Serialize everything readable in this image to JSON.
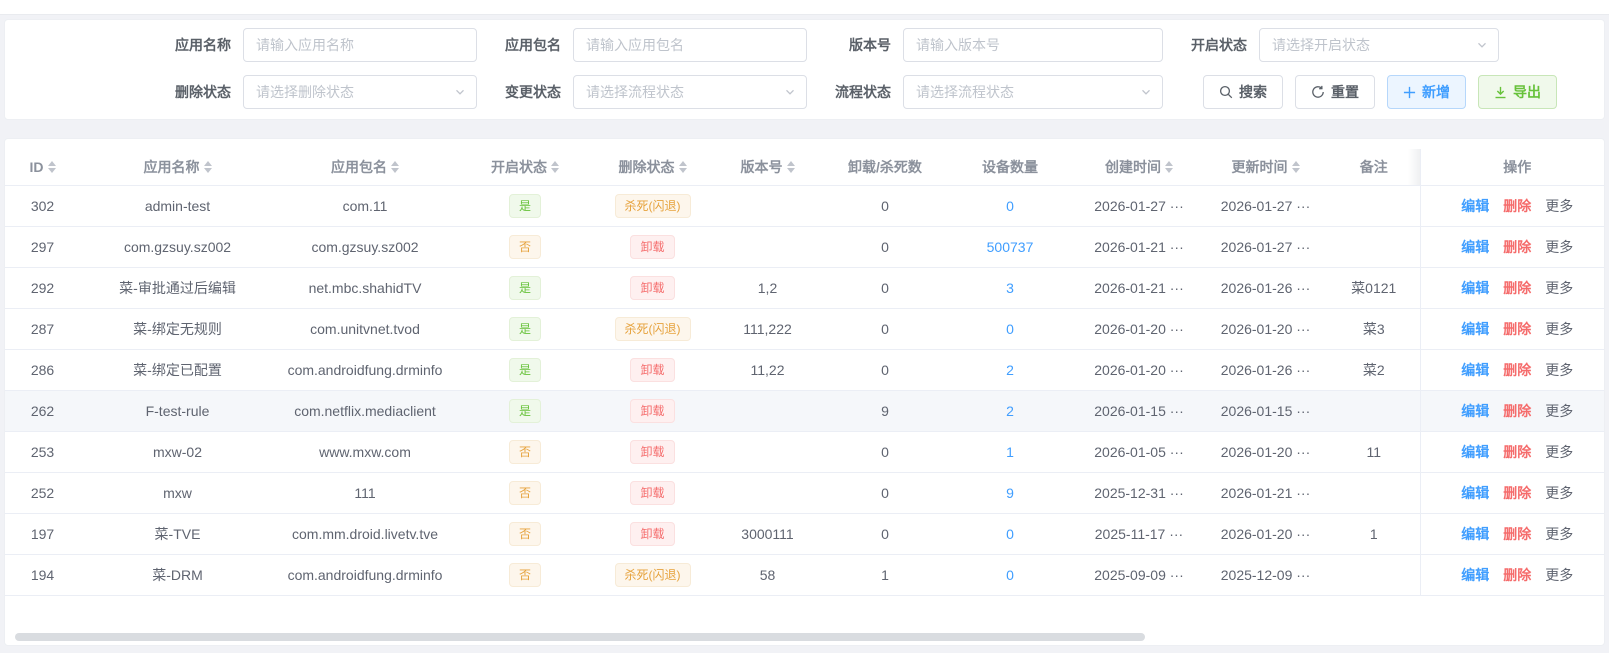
{
  "colors": {
    "primary": "#409eff",
    "success": "#67c23a",
    "warning": "#e6a23c",
    "danger": "#f56c6c",
    "page_background": "#f1f2f6"
  },
  "filter": {
    "fields": [
      {
        "row": 1,
        "key": "app-name",
        "label": "应用名称",
        "type": "input",
        "placeholder": "请输入应用名称"
      },
      {
        "row": 1,
        "key": "app-package",
        "label": "应用包名",
        "type": "input",
        "placeholder": "请输入应用包名"
      },
      {
        "row": 1,
        "key": "version",
        "label": "版本号",
        "type": "input",
        "placeholder": "请输入版本号"
      },
      {
        "row": 1,
        "key": "enable-status",
        "label": "开启状态",
        "type": "select",
        "placeholder": "请选择开启状态"
      },
      {
        "row": 2,
        "key": "delete-status",
        "label": "删除状态",
        "type": "select",
        "placeholder": "请选择删除状态"
      },
      {
        "row": 2,
        "key": "change-status",
        "label": "变更状态",
        "type": "select",
        "placeholder": "请选择流程状态"
      },
      {
        "row": 2,
        "key": "process-status",
        "label": "流程状态",
        "type": "select",
        "placeholder": "请选择流程状态"
      }
    ],
    "buttons": [
      {
        "key": "search",
        "label": "搜索",
        "icon": "search-icon",
        "variant": "default"
      },
      {
        "key": "reset",
        "label": "重置",
        "icon": "refresh-icon",
        "variant": "default"
      },
      {
        "key": "add",
        "label": "新增",
        "icon": "plus-icon",
        "variant": "primary"
      },
      {
        "key": "export",
        "label": "导出",
        "icon": "download-icon",
        "variant": "success"
      }
    ]
  },
  "table": {
    "columns": [
      {
        "key": "id",
        "label": "ID",
        "sortable": true
      },
      {
        "key": "name",
        "label": "应用名称",
        "sortable": true
      },
      {
        "key": "package",
        "label": "应用包名",
        "sortable": true
      },
      {
        "key": "enabled",
        "label": "开启状态",
        "sortable": true
      },
      {
        "key": "delstate",
        "label": "删除状态",
        "sortable": true
      },
      {
        "key": "version",
        "label": "版本号",
        "sortable": true
      },
      {
        "key": "killcount",
        "label": "卸载/杀死数",
        "sortable": false
      },
      {
        "key": "devices",
        "label": "设备数量",
        "sortable": false
      },
      {
        "key": "created",
        "label": "创建时间",
        "sortable": true
      },
      {
        "key": "updated",
        "label": "更新时间",
        "sortable": true
      },
      {
        "key": "remark",
        "label": "备注",
        "sortable": false
      },
      {
        "key": "actions",
        "label": "操作",
        "sortable": false
      }
    ],
    "action_labels": {
      "edit": "编辑",
      "delete": "删除",
      "more": "更多"
    },
    "rows": [
      {
        "id": "302",
        "name": "admin-test",
        "package": "com.11",
        "enabled": {
          "text": "是",
          "type": "success"
        },
        "delete_state": {
          "text": "杀死(闪退)",
          "type": "warning"
        },
        "version": "",
        "uninstall_kill_count": "0",
        "device_count": "0",
        "created": "2026-01-27 ···",
        "updated": "2026-01-27 ···",
        "remark": "",
        "highlighted": false
      },
      {
        "id": "297",
        "name": "com.gzsuy.sz002",
        "package": "com.gzsuy.sz002",
        "enabled": {
          "text": "否",
          "type": "warning"
        },
        "delete_state": {
          "text": "卸载",
          "type": "danger"
        },
        "version": "",
        "uninstall_kill_count": "0",
        "device_count": "500737",
        "created": "2026-01-21 ···",
        "updated": "2026-01-27 ···",
        "remark": "",
        "highlighted": false
      },
      {
        "id": "292",
        "name": "菜-审批通过后编辑",
        "package": "net.mbc.shahidTV",
        "enabled": {
          "text": "是",
          "type": "success"
        },
        "delete_state": {
          "text": "卸载",
          "type": "danger"
        },
        "version": "1,2",
        "uninstall_kill_count": "0",
        "device_count": "3",
        "created": "2026-01-21 ···",
        "updated": "2026-01-26 ···",
        "remark": "菜0121",
        "highlighted": false
      },
      {
        "id": "287",
        "name": "菜-绑定无规则",
        "package": "com.unitvnet.tvod",
        "enabled": {
          "text": "是",
          "type": "success"
        },
        "delete_state": {
          "text": "杀死(闪退)",
          "type": "warning"
        },
        "version": "111,222",
        "uninstall_kill_count": "0",
        "device_count": "0",
        "created": "2026-01-20 ···",
        "updated": "2026-01-20 ···",
        "remark": "菜3",
        "highlighted": false
      },
      {
        "id": "286",
        "name": "菜-绑定已配置",
        "package": "com.androidfung.drminfo",
        "enabled": {
          "text": "是",
          "type": "success"
        },
        "delete_state": {
          "text": "卸载",
          "type": "danger"
        },
        "version": "11,22",
        "uninstall_kill_count": "0",
        "device_count": "2",
        "created": "2026-01-20 ···",
        "updated": "2026-01-26 ···",
        "remark": "菜2",
        "highlighted": false
      },
      {
        "id": "262",
        "name": "F-test-rule",
        "package": "com.netflix.mediaclient",
        "enabled": {
          "text": "是",
          "type": "success"
        },
        "delete_state": {
          "text": "卸载",
          "type": "danger"
        },
        "version": "",
        "uninstall_kill_count": "9",
        "device_count": "2",
        "created": "2026-01-15 ···",
        "updated": "2026-01-15 ···",
        "remark": "",
        "highlighted": true
      },
      {
        "id": "253",
        "name": "mxw-02",
        "package": "www.mxw.com",
        "enabled": {
          "text": "否",
          "type": "warning"
        },
        "delete_state": {
          "text": "卸载",
          "type": "danger"
        },
        "version": "",
        "uninstall_kill_count": "0",
        "device_count": "1",
        "created": "2026-01-05 ···",
        "updated": "2026-01-20 ···",
        "remark": "11",
        "highlighted": false
      },
      {
        "id": "252",
        "name": "mxw",
        "package": "111",
        "enabled": {
          "text": "否",
          "type": "warning"
        },
        "delete_state": {
          "text": "卸载",
          "type": "danger"
        },
        "version": "",
        "uninstall_kill_count": "0",
        "device_count": "9",
        "created": "2025-12-31 ···",
        "updated": "2026-01-21 ···",
        "remark": "",
        "highlighted": false
      },
      {
        "id": "197",
        "name": "菜-TVE",
        "package": "com.mm.droid.livetv.tve",
        "enabled": {
          "text": "否",
          "type": "warning"
        },
        "delete_state": {
          "text": "卸载",
          "type": "danger"
        },
        "version": "3000111",
        "uninstall_kill_count": "0",
        "device_count": "0",
        "created": "2025-11-17 ···",
        "updated": "2026-01-20 ···",
        "remark": "1",
        "highlighted": false
      },
      {
        "id": "194",
        "name": "菜-DRM",
        "package": "com.androidfung.drminfo",
        "enabled": {
          "text": "否",
          "type": "warning"
        },
        "delete_state": {
          "text": "杀死(闪退)",
          "type": "warning"
        },
        "version": "58",
        "uninstall_kill_count": "1",
        "device_count": "0",
        "created": "2025-09-09 ···",
        "updated": "2025-12-09 ···",
        "remark": "",
        "highlighted": false
      }
    ]
  }
}
